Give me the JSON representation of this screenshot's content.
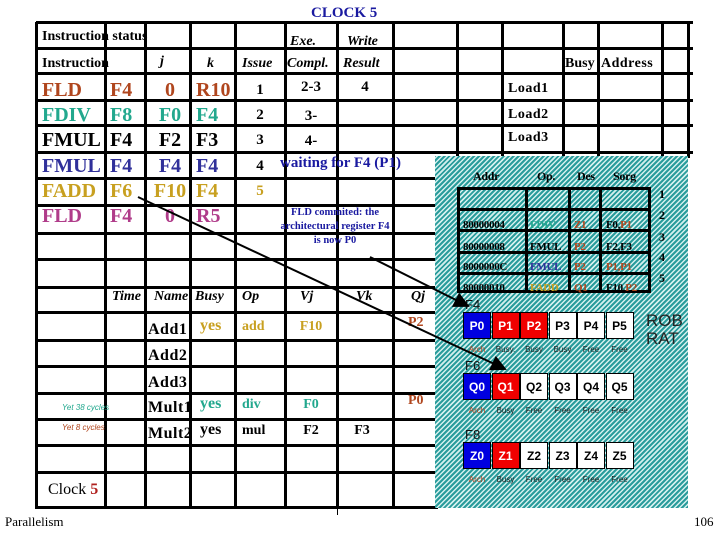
{
  "title": "CLOCK 5",
  "colors": {
    "rust": "#b0461e",
    "teal": "#22a88e",
    "black": "#000000",
    "blue": "#30309a",
    "gold": "#c8a020",
    "magenta": "#b03c8a",
    "title_blue": "#1a1aa0",
    "arch": "#b0401e",
    "p_blue": "#0000e0",
    "p_red": "#f00000"
  },
  "instruction_status": {
    "section_label": "Instruction status",
    "headers": {
      "instruction": "Instruction",
      "j": "j",
      "k": "k",
      "issue": "Issue",
      "exe_top": "Exe.",
      "exe_bottom": "Compl.",
      "write_top": "Write",
      "write_bottom": "Result"
    },
    "rows": [
      {
        "op": "FLD",
        "dest": "F4",
        "j": "0",
        "k": "R10",
        "issue": "1",
        "exe": "2-3",
        "write": "4",
        "color": "#b0461e"
      },
      {
        "op": "FDIV",
        "dest": "F8",
        "j": "F0",
        "k": "F4",
        "issue": "2",
        "exe": "3-",
        "write": "",
        "color": "#22a88e"
      },
      {
        "op": "FMUL",
        "dest": "F4",
        "j": "F2",
        "k": "F3",
        "issue": "3",
        "exe": "4-",
        "write": "",
        "color": "#000000"
      },
      {
        "op": "FMUL",
        "dest": "F4",
        "j": "F4",
        "k": "F4",
        "issue": "4",
        "exe": "",
        "write": "",
        "color": "#30309a"
      },
      {
        "op": "FADD",
        "dest": "F6",
        "j": "F10",
        "k": "F4",
        "issue": "5",
        "exe": "",
        "write": "",
        "color": "#c8a020"
      },
      {
        "op": "FLD",
        "dest": "F4",
        "j": "0",
        "k": "R5",
        "issue": "",
        "exe": "",
        "write": "",
        "color": "#b03c8a"
      }
    ],
    "waiting_note": "waiting for F4 (P1)",
    "commit_note": [
      "FLD commited: the",
      "architectural register  F4",
      "is now P0"
    ]
  },
  "load_buffers": {
    "headers": {
      "busy": "Busy",
      "address": "Address"
    },
    "names": [
      "Load1",
      "Load2",
      "Load3"
    ]
  },
  "reservation_stations": {
    "headers": {
      "time": "Time",
      "name": "Name",
      "busy": "Busy",
      "op": "Op",
      "vj": "Vj",
      "vk": "Vk",
      "qj": "Qj"
    },
    "rows": [
      {
        "name": "Add1",
        "busy": "yes",
        "op": "add",
        "vj": "F10",
        "vk": "",
        "qj": "P2",
        "note": ""
      },
      {
        "name": "Add2",
        "busy": "",
        "op": "",
        "vj": "",
        "vk": "",
        "qj": "",
        "note": ""
      },
      {
        "name": "Add3",
        "busy": "",
        "op": "",
        "vj": "",
        "vk": "",
        "qj": "",
        "note": ""
      },
      {
        "name": "Mult1",
        "busy": "yes",
        "op": "div",
        "vj": "F0",
        "vk": "",
        "qj": "P0",
        "note": "Yet 38 cycles"
      },
      {
        "name": "Mult2",
        "busy": "yes",
        "op": "mul",
        "vj": "F2",
        "vk": "F3",
        "qj": "",
        "note": "Yet 8 cycles"
      }
    ]
  },
  "clock": {
    "label": "Clock",
    "value": "5"
  },
  "rob": {
    "headers": {
      "addr": "Addr",
      "op": "Op.",
      "des": "Des",
      "sorg": "Sorg"
    },
    "entries": [
      {
        "index": "1",
        "addr": "",
        "op": "",
        "des": "",
        "sorg1": "",
        "sorg2": ""
      },
      {
        "index": "2",
        "addr": "80000004",
        "op": "FDIV",
        "op_color": "#22a88e",
        "des": "Z1",
        "sorg1": "F0,",
        "sorg1_color": "#000000",
        "sorg2": "P1"
      },
      {
        "index": "3",
        "addr": "80000008",
        "op": "FMUL",
        "op_color": "#000000",
        "des": "P2",
        "sorg1": "F2,F3",
        "sorg1_color": "#000000",
        "sorg2": ""
      },
      {
        "index": "4",
        "addr": "8000000C",
        "op": "FMUL",
        "op_color": "#30309a",
        "des": "P2",
        "sorg1": "P1,P1",
        "sorg1_color": "#b0461e",
        "sorg2": ""
      },
      {
        "index": "5",
        "addr": "80000010",
        "op": "FADD",
        "op_color": "#c8a020",
        "des": "Q1",
        "sorg1": "F10,",
        "sorg1_color": "#000000",
        "sorg2": "P2"
      }
    ]
  },
  "rename": {
    "side_labels": [
      "ROB",
      "RAT"
    ],
    "registers": [
      {
        "arch": "F4",
        "cells": [
          "P0",
          "P1",
          "P2",
          "P3",
          "P4",
          "P5"
        ],
        "states": [
          "arch",
          "busy",
          "busy",
          "free",
          "free",
          "free"
        ],
        "labels": [
          "Arch",
          "Busy.",
          "Busy",
          "Busy",
          "Free",
          "Free"
        ]
      },
      {
        "arch": "F6",
        "cells": [
          "Q0",
          "Q1",
          "Q2",
          "Q3",
          "Q4",
          "Q5"
        ],
        "states": [
          "arch",
          "busy",
          "free",
          "free",
          "free",
          "free"
        ],
        "labels": [
          "Arch",
          "Busy",
          "Free",
          "Free",
          "Free",
          "Free"
        ]
      },
      {
        "arch": "F8",
        "cells": [
          "Z0",
          "Z1",
          "Z2",
          "Z3",
          "Z4",
          "Z5"
        ],
        "states": [
          "arch",
          "busy",
          "free",
          "free",
          "free",
          "free"
        ],
        "labels": [
          "Arch",
          "Busy",
          "Free",
          "Free",
          "Free",
          "Free"
        ]
      }
    ]
  },
  "footer": {
    "left": "Parallelism",
    "page": "106"
  }
}
